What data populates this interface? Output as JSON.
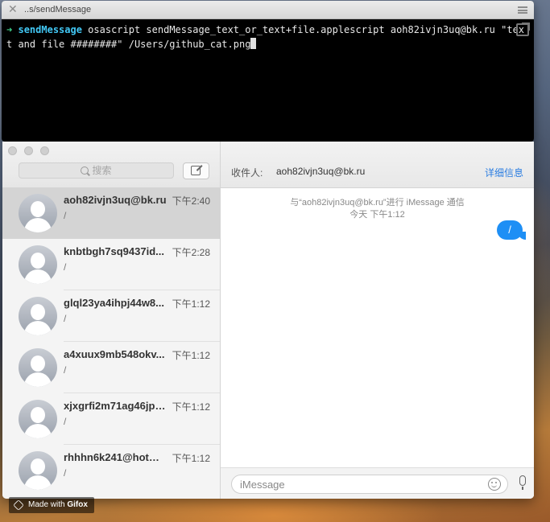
{
  "terminal": {
    "title": "..s/sendMessage",
    "prompt_arrow": "➜",
    "prompt_dir": "sendMessage",
    "command": " osascript sendMessage_text_or_text+file.applescript aoh82ivjn3uq@bk.ru \"text and file ########\" /Users/github_cat.png"
  },
  "messages": {
    "search_placeholder": "搜索",
    "conversations": [
      {
        "name": "aoh82ivjn3uq@bk.ru",
        "time": "下午2:40",
        "preview": "/",
        "selected": true
      },
      {
        "name": "knbtbgh7sq9437id...",
        "time": "下午2:28",
        "preview": "/"
      },
      {
        "name": "glql23ya4ihpj44w8...",
        "time": "下午1:12",
        "preview": "/"
      },
      {
        "name": "a4xuux9mb548okv...",
        "time": "下午1:12",
        "preview": "/"
      },
      {
        "name": "xjxgrfi2m71ag46jpe...",
        "time": "下午1:12",
        "preview": "/"
      },
      {
        "name": "rhhhn6k241@hotm...",
        "time": "下午1:12",
        "preview": "/"
      }
    ],
    "chat": {
      "to_label": "收件人:",
      "to_value": "aoh82ivjn3uq@bk.ru",
      "details_label": "详细信息",
      "info_line1": "与“aoh82ivjn3uq@bk.ru”进行 iMessage 通信",
      "info_line2": "今天 下午1:12",
      "bubble_text": "/",
      "input_placeholder": "iMessage"
    }
  },
  "watermark": {
    "prefix": "Made with ",
    "brand": "Gifox"
  },
  "colors": {
    "accent": "#1e8ff5",
    "link": "#2b7de1",
    "prompt_arrow": "#3fd08a",
    "prompt_dir": "#42c8f5"
  }
}
